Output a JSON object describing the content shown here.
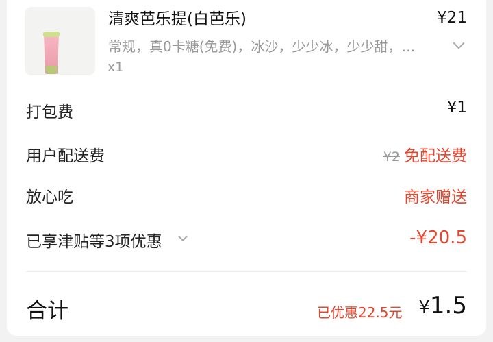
{
  "product": {
    "name": "清爽芭乐提(白芭乐)",
    "price": "¥21",
    "spec": "常规，真0卡糖(免费)，冰沙，少少冰，少少甜，…",
    "quantity": "x1"
  },
  "fees": [
    {
      "label": "打包费",
      "value": "¥1"
    },
    {
      "label": "用户配送费",
      "original": "¥2",
      "value": "免配送费"
    },
    {
      "label": "放心吃",
      "value": "商家赠送"
    },
    {
      "label": "已享津贴等3项优惠",
      "value": "-¥20.5"
    }
  ],
  "total": {
    "label": "合计",
    "saved": "已优惠22.5元",
    "currency": "¥",
    "amount": "1.5"
  },
  "colors": {
    "accent": "#e8452c",
    "muted": "#999999"
  },
  "icons": [
    "chevron-down-icon"
  ]
}
